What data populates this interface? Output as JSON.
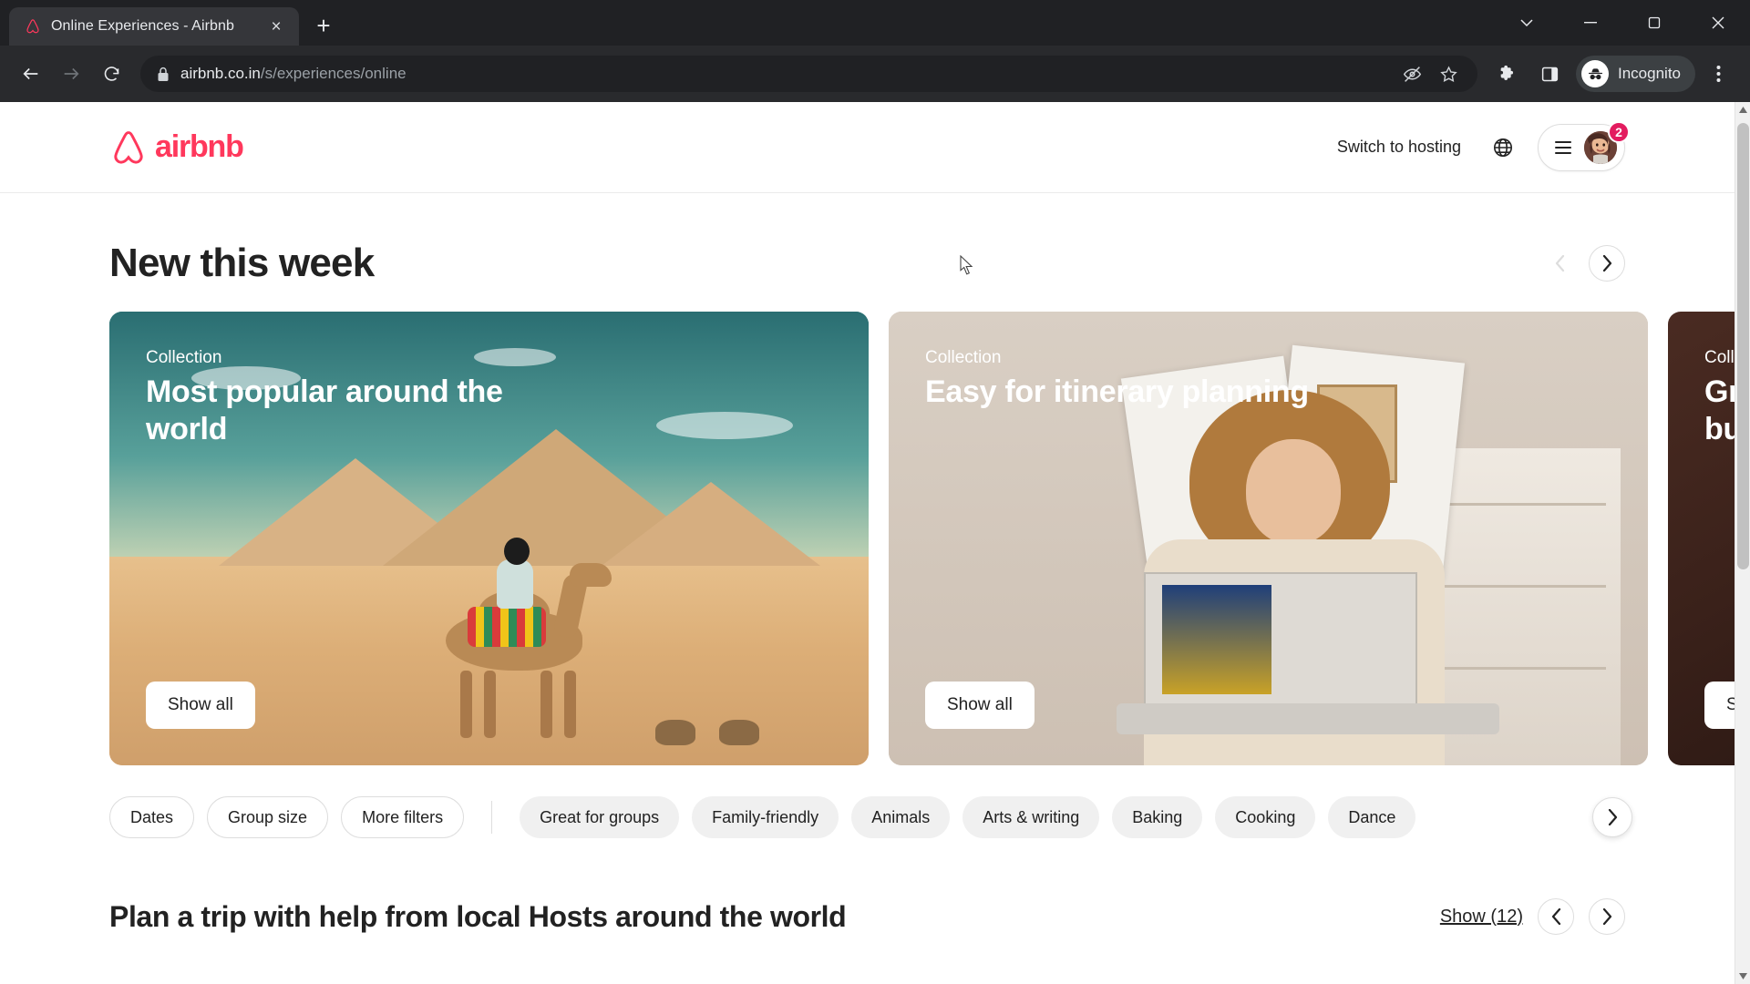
{
  "browser": {
    "tab": {
      "title": "Online Experiences - Airbnb",
      "favicon_name": "airbnb-favicon",
      "close_label": "×"
    },
    "new_tab_label": "+",
    "window_controls": {
      "minimize": "–",
      "maximize": "❑",
      "close": "✕",
      "chevron": "⌄"
    },
    "nav": {
      "back": "back-arrow",
      "forward": "forward-arrow",
      "reload": "reload"
    },
    "omnibox": {
      "lock_icon": "lock-icon",
      "url_domain": "airbnb.co.in",
      "url_path": "/s/experiences/online",
      "full_url": "airbnb.co.in/s/experiences/online"
    },
    "toolbar_icons": [
      "eye-slash-icon",
      "star-icon",
      "extensions-puzzle-icon",
      "side-panel-icon"
    ],
    "profile": {
      "label": "Incognito",
      "icon": "incognito-hat-icon"
    },
    "menu_label": "⋮"
  },
  "site": {
    "logo": {
      "word": "airbnb",
      "color": "#FF385C"
    },
    "header": {
      "hosting_link": "Switch to hosting",
      "globe_icon": "globe-icon",
      "menu_icon": "hamburger-icon",
      "avatar_name": "user-avatar",
      "notification_count": "2"
    }
  },
  "new_this_week": {
    "title": "New this week",
    "prev_arrow": "‹",
    "next_arrow": "›",
    "cards": [
      {
        "eyebrow": "Collection",
        "title": "Most popular around the world",
        "button": "Show all",
        "theme": "desert"
      },
      {
        "eyebrow": "Collection",
        "title": "Easy for itinerary planning",
        "button": "Show all",
        "theme": "room"
      },
      {
        "eyebrow": "Collect",
        "title_line1": "Grea",
        "title_line2": "buil",
        "button": "Sho",
        "theme": "dark"
      }
    ]
  },
  "filters": {
    "primary": [
      "Dates",
      "Group size",
      "More filters"
    ],
    "categories": [
      "Great for groups",
      "Family-friendly",
      "Animals",
      "Arts & writing",
      "Baking",
      "Cooking",
      "Dance"
    ],
    "scroll_next": "›"
  },
  "plan_trip": {
    "title": "Plan a trip with help from local Hosts around the world",
    "show_link": "Show (12)",
    "prev_arrow": "‹",
    "next_arrow": "›"
  }
}
